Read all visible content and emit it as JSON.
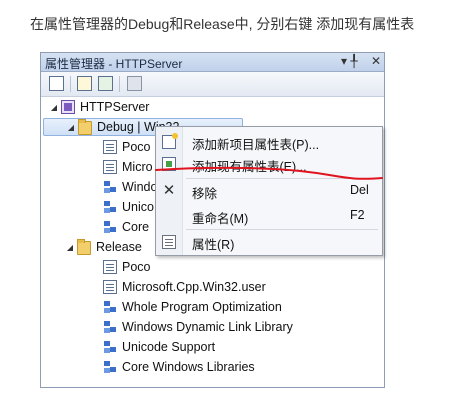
{
  "caption": "在属性管理器的Debug和Release中, 分别右键 添加现有属性表",
  "panel": {
    "title": "属性管理器 - HTTPServer",
    "pin_glyph": "▾ ╀",
    "close_glyph": "✕"
  },
  "toolbar": {
    "icons": [
      "properties-icon",
      "add-new-sheet-icon",
      "add-existing-sheet-icon",
      "save-icon"
    ]
  },
  "tree": {
    "project": "HTTPServer",
    "debug": {
      "label": "Debug | Win32",
      "children": [
        "Poco",
        "Micro",
        "Windo",
        "Unico",
        "Core"
      ]
    },
    "release": {
      "label": "Release",
      "children": [
        "Poco",
        "Microsoft.Cpp.Win32.user",
        "Whole Program Optimization",
        "Windows Dynamic Link Library",
        "Unicode Support",
        "Core Windows Libraries"
      ]
    }
  },
  "context_menu": {
    "items": [
      {
        "label": "添加新项目属性表(P)...",
        "shortcut": ""
      },
      {
        "label": "添加现有属性表(E)...",
        "shortcut": ""
      },
      {
        "label": "移除",
        "shortcut": "Del"
      },
      {
        "label": "重命名(M)",
        "shortcut": "F2"
      },
      {
        "label": "属性(R)",
        "shortcut": ""
      }
    ]
  },
  "colors": {
    "annotation": "#e0141e",
    "selection": "#cfe0f6"
  }
}
